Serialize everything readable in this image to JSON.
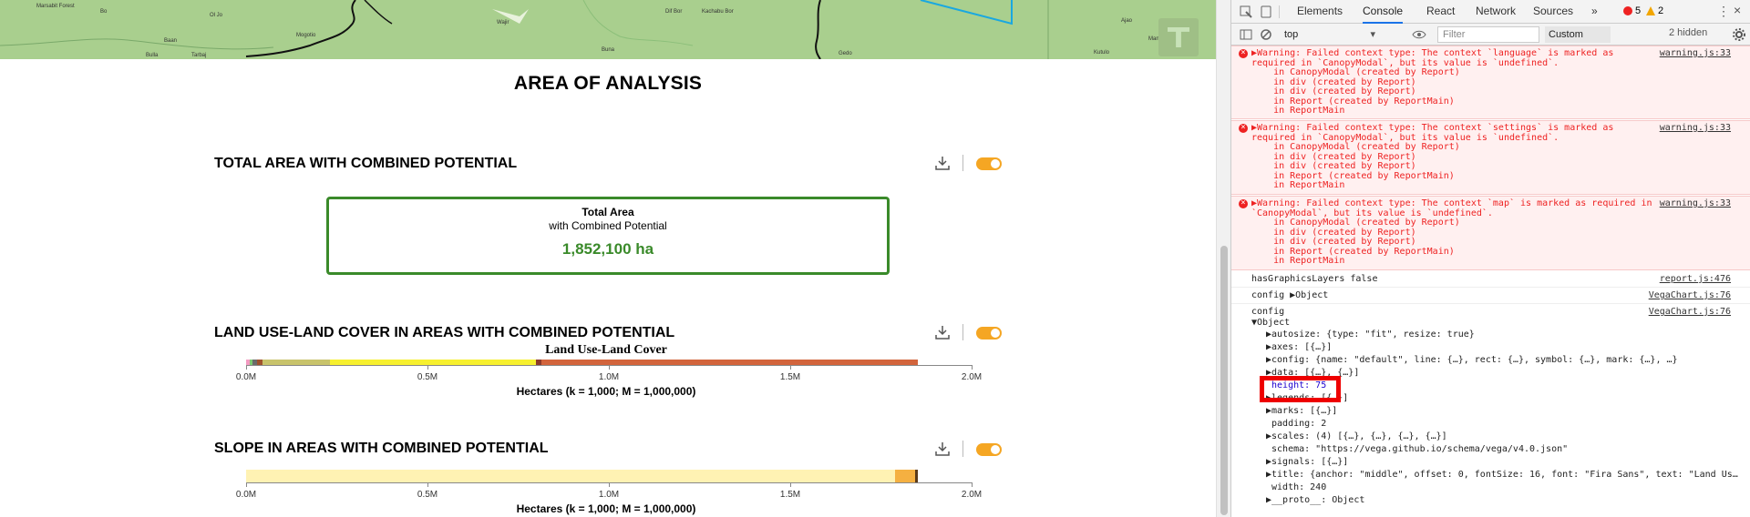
{
  "map": {
    "labels": [
      "Marsabit Forest",
      "Bo",
      "Ol Jo",
      "Mogotio",
      "Wajir",
      "Dif Bor",
      "Kachabu Bor",
      "Gedo",
      "Baan",
      "Mandera",
      "Buna",
      "Tarbaj",
      "Bulla",
      "Ajao",
      "Kutulo"
    ],
    "accent": "#1aa8e0"
  },
  "report": {
    "area_title": "AREA OF ANALYSIS",
    "sections": [
      {
        "title": "TOTAL AREA WITH COMBINED POTENTIAL"
      },
      {
        "title": "LAND USE-LAND COVER IN AREAS WITH COMBINED POTENTIAL"
      },
      {
        "title": "SLOPE IN AREAS WITH COMBINED POTENTIAL"
      }
    ],
    "total_box": {
      "title": "Total Area",
      "subtitle": "with Combined Potential",
      "value": "1,852,100 ha"
    },
    "accent_green": "#3a8a2a",
    "toggle_color": "#f5a623"
  },
  "chart_data": [
    {
      "type": "bar",
      "title": "Land Use-Land Cover",
      "xlabel": "Hectares (k = 1,000; M = 1,000,000)",
      "ylabel": "",
      "xlim": [
        0,
        2000000
      ],
      "ticks": [
        "0.0M",
        "0.5M",
        "1.0M",
        "1.5M",
        "2.0M"
      ],
      "series": [
        {
          "values": [
            10000
          ],
          "color": "#f49ac2"
        },
        {
          "values": [
            8000
          ],
          "color": "#7bc96f"
        },
        {
          "values": [
            12000
          ],
          "color": "#6b6b6b"
        },
        {
          "values": [
            15000
          ],
          "color": "#a0522d"
        },
        {
          "values": [
            185000
          ],
          "color": "#c8c36b"
        },
        {
          "values": [
            570000
          ],
          "color": "#f7f02e"
        },
        {
          "values": [
            15000
          ],
          "color": "#8b3a2a"
        },
        {
          "values": [
            1037100
          ],
          "color": "#d2643c"
        }
      ]
    },
    {
      "type": "bar",
      "title": "",
      "xlabel": "Hectares (k = 1,000; M = 1,000,000)",
      "ylabel": "",
      "xlim": [
        0,
        2000000
      ],
      "ticks": [
        "0.0M",
        "0.5M",
        "1.0M",
        "1.5M",
        "2.0M"
      ],
      "series": [
        {
          "values": [
            1790000
          ],
          "color": "#fff2b3"
        },
        {
          "values": [
            55000
          ],
          "color": "#f5b041"
        },
        {
          "values": [
            7100
          ],
          "color": "#5a3a1a"
        }
      ]
    }
  ],
  "devtools": {
    "tabs": [
      "Elements",
      "Console",
      "React",
      "Network",
      "Sources",
      "»"
    ],
    "error_count": "5",
    "warning_count": "2",
    "context": "top",
    "filter_placeholder": "Filter",
    "levels": "Custom levels ▾",
    "hidden": "2 hidden",
    "messages": [
      {
        "type": "error",
        "source": "warning.js:33",
        "lines": [
          "▶Warning: Failed context type: The context `language` is marked as",
          "required in `CanopyModal`, but its value is `undefined`.",
          "    in CanopyModal (created by Report)",
          "    in div (created by Report)",
          "    in div (created by Report)",
          "    in Report (created by ReportMain)",
          "    in ReportMain"
        ]
      },
      {
        "type": "error",
        "source": "warning.js:33",
        "lines": [
          "▶Warning: Failed context type: The context `settings` is marked as",
          "required in `CanopyModal`, but its value is `undefined`.",
          "    in CanopyModal (created by Report)",
          "    in div (created by Report)",
          "    in div (created by Report)",
          "    in Report (created by ReportMain)",
          "    in ReportMain"
        ]
      },
      {
        "type": "error",
        "source": "warning.js:33",
        "lines": [
          "▶Warning: Failed context type: The context `map` is marked as required in",
          "`CanopyModal`, but its value is `undefined`.",
          "    in CanopyModal (created by Report)",
          "    in div (created by Report)",
          "    in div (created by Report)",
          "    in Report (created by ReportMain)",
          "    in ReportMain"
        ]
      }
    ],
    "log1": {
      "text": "hasGraphicsLayers false",
      "source": "report.js:476"
    },
    "log2": {
      "text": "config ▶Object",
      "source": "VegaChart.js:76"
    },
    "log3": {
      "text": "config",
      "source": "VegaChart.js:76"
    },
    "object_head": "▼Object",
    "props": [
      "▶autosize: {type: \"fit\", resize: true}",
      "▶axes: [{…}]",
      "▶config: {name: \"default\", line: {…}, rect: {…}, symbol: {…}, mark: {…}, …}",
      "▶data: [{…}, {…}]",
      " height: 75",
      "▶legends: [{…}]",
      "▶marks: [{…}]",
      " padding: 2",
      "▶scales: (4) [{…}, {…}, {…}, {…}]",
      " schema: \"https://vega.github.io/schema/vega/v4.0.json\"",
      "▶signals: [{…}]",
      "▶title: {anchor: \"middle\", offset: 0, fontSize: 16, font: \"Fira Sans\", text: \"Land Us…",
      " width: 240",
      "▶__proto__: Object"
    ]
  }
}
